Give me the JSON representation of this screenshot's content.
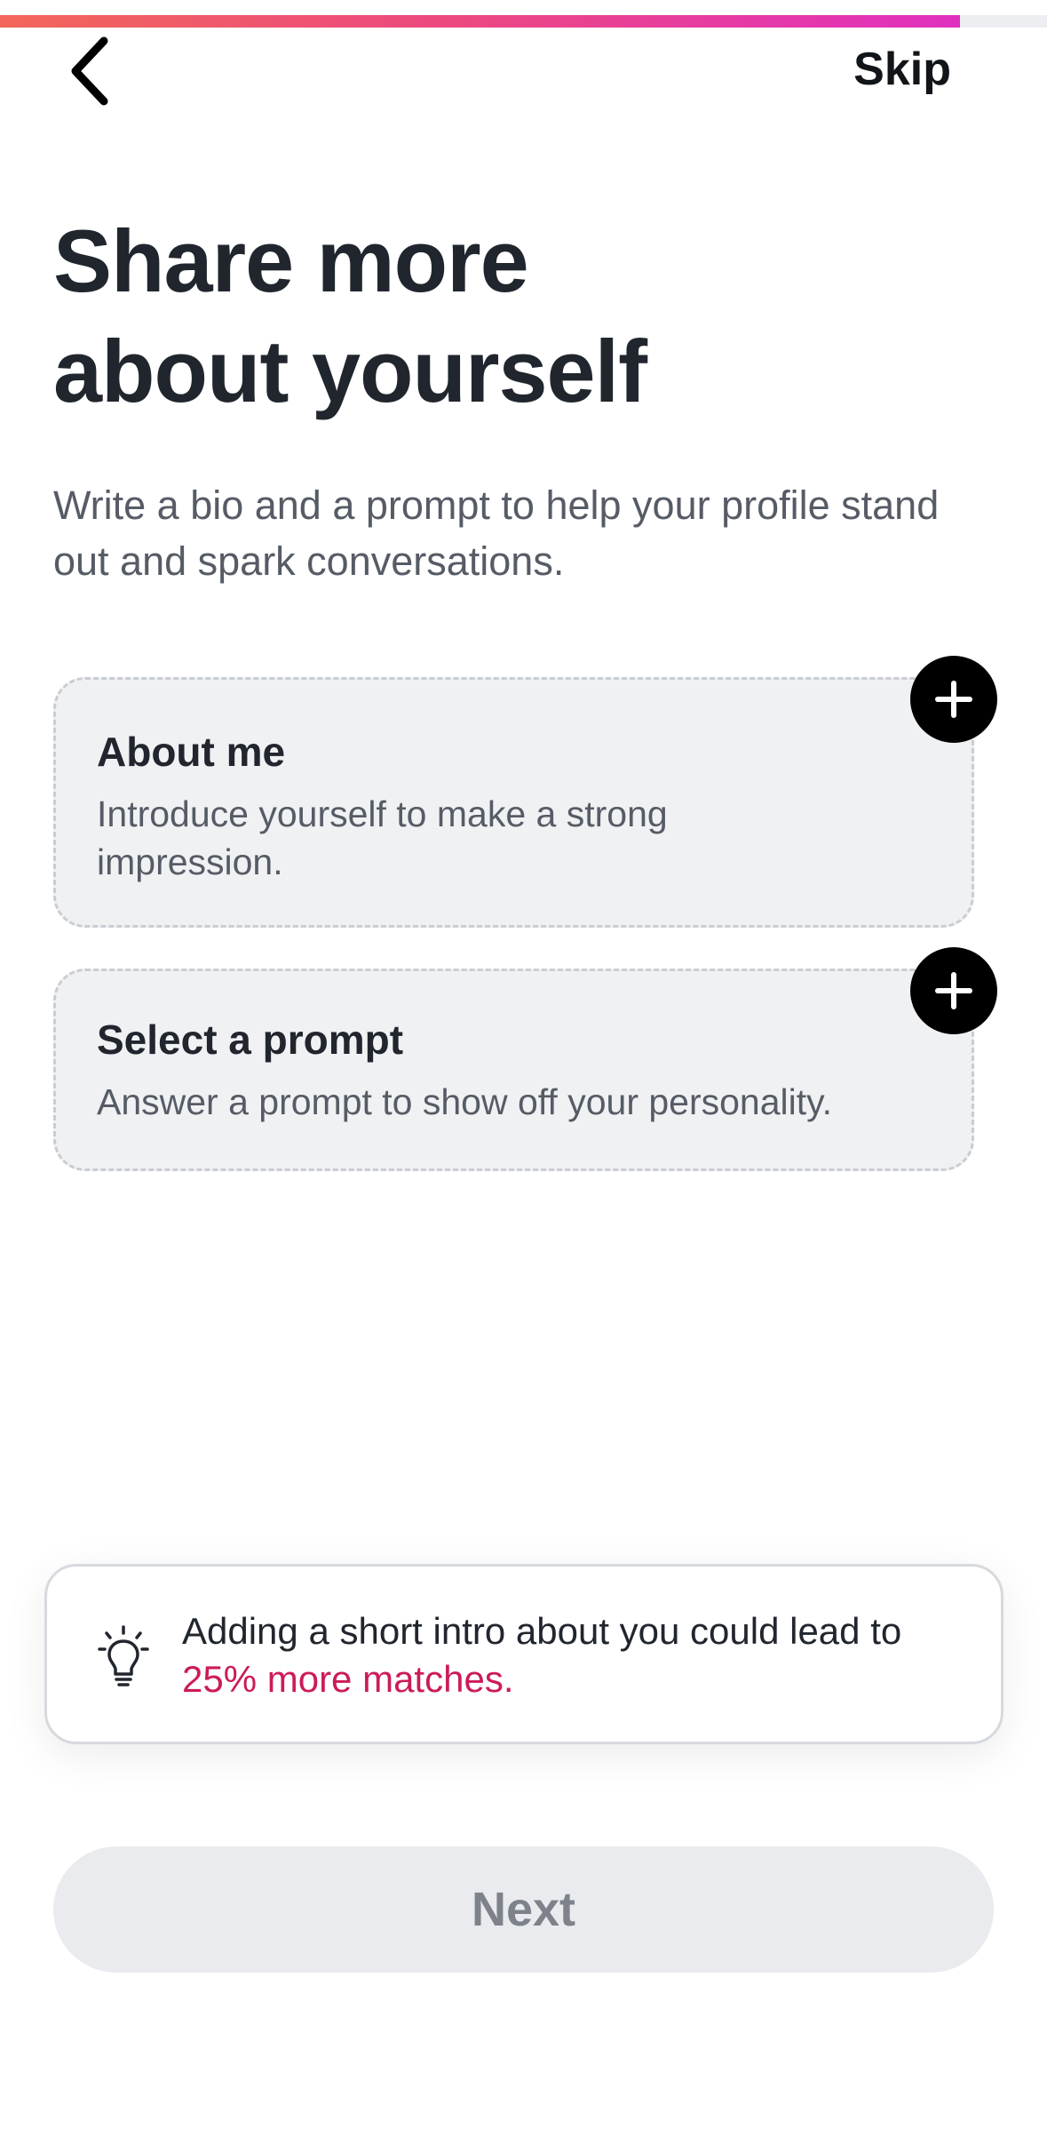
{
  "progress": {
    "value_percent": 91.7,
    "gradient_colors": [
      "#f2675a",
      "#ec4a7e",
      "#e030c0"
    ]
  },
  "header": {
    "back_icon": "chevron-left-icon",
    "skip_label": "Skip"
  },
  "title": {
    "line1": "Share more",
    "line2": "about yourself"
  },
  "subtitle": "Write a bio and a prompt to help your profile stand out and spark conversations.",
  "cards": [
    {
      "title": "About me",
      "description": "Introduce yourself to make a strong impression.",
      "action_icon": "plus-icon"
    },
    {
      "title": "Select a prompt",
      "description": "Answer a prompt to show off your personality.",
      "action_icon": "plus-icon"
    }
  ],
  "tip": {
    "icon": "lightbulb-icon",
    "text": "Adding a short intro about you could lead to",
    "highlight": "25% more matches.",
    "highlight_color": "#cc1b5a"
  },
  "footer": {
    "next_label": "Next",
    "next_disabled": true
  }
}
